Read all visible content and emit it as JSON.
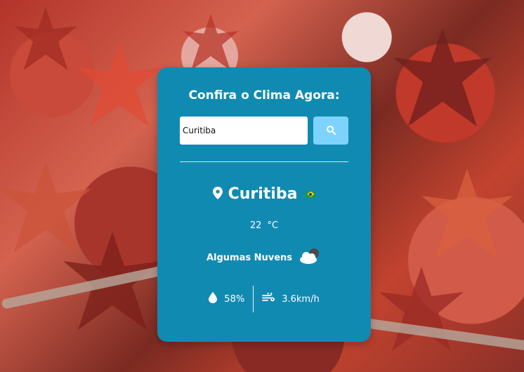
{
  "widget": {
    "title": "Confira o Clima Agora:",
    "search": {
      "value": "Curitiba",
      "placeholder": ""
    },
    "city": {
      "name": "Curitiba",
      "country_flag": "brazil-flag"
    },
    "temperature": {
      "value": "22",
      "unit": "°C"
    },
    "description": "Algumas Nuvens",
    "humidity": "58%",
    "wind": "3.6km/h"
  },
  "colors": {
    "card_bg": "#118ab2",
    "search_button": "#7dd3fc",
    "text": "#ffffff"
  },
  "icons": {
    "search": "search-icon",
    "location": "map-pin-icon",
    "weather": "cloud-sun-icon",
    "humidity": "water-drop-icon",
    "wind": "wind-icon"
  }
}
